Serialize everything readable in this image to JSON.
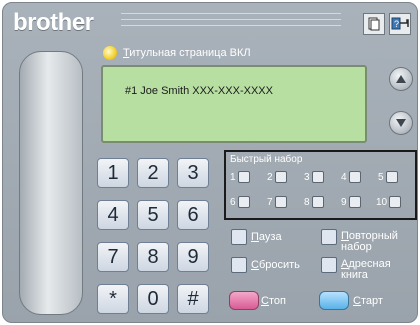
{
  "brand": "brother",
  "title_page_label": "Титульная страница ВКЛ",
  "title_page_label_first": "Т",
  "title_page_label_rest": "итульная страница ВКЛ",
  "lcd_text": "#1 Joe Smith XXX-XXX-XXXX",
  "keypad": [
    "1",
    "2",
    "3",
    "4",
    "5",
    "6",
    "7",
    "8",
    "9",
    "*",
    "0",
    "#"
  ],
  "speed_dial": {
    "title": "Быстрый набор",
    "items": [
      "1",
      "2",
      "3",
      "4",
      "5",
      "6",
      "7",
      "8",
      "9",
      "10"
    ]
  },
  "functions": {
    "pause_first": "П",
    "pause_rest": "ауза",
    "redial_first": "П",
    "redial_rest": "овторный",
    "redial_line2": "набор",
    "reset_first": "С",
    "reset_rest": "бросить",
    "address_first": "А",
    "address_rest": "дресная",
    "address_line2": "книга"
  },
  "stop_first": "С",
  "stop_rest": "топ",
  "start_first": "С",
  "start_rest": "тарт",
  "colors": {
    "panel": "#9aa3ab",
    "lcd": "#b8dfa2",
    "stop": "#d85c95",
    "start": "#5ab2e8"
  }
}
